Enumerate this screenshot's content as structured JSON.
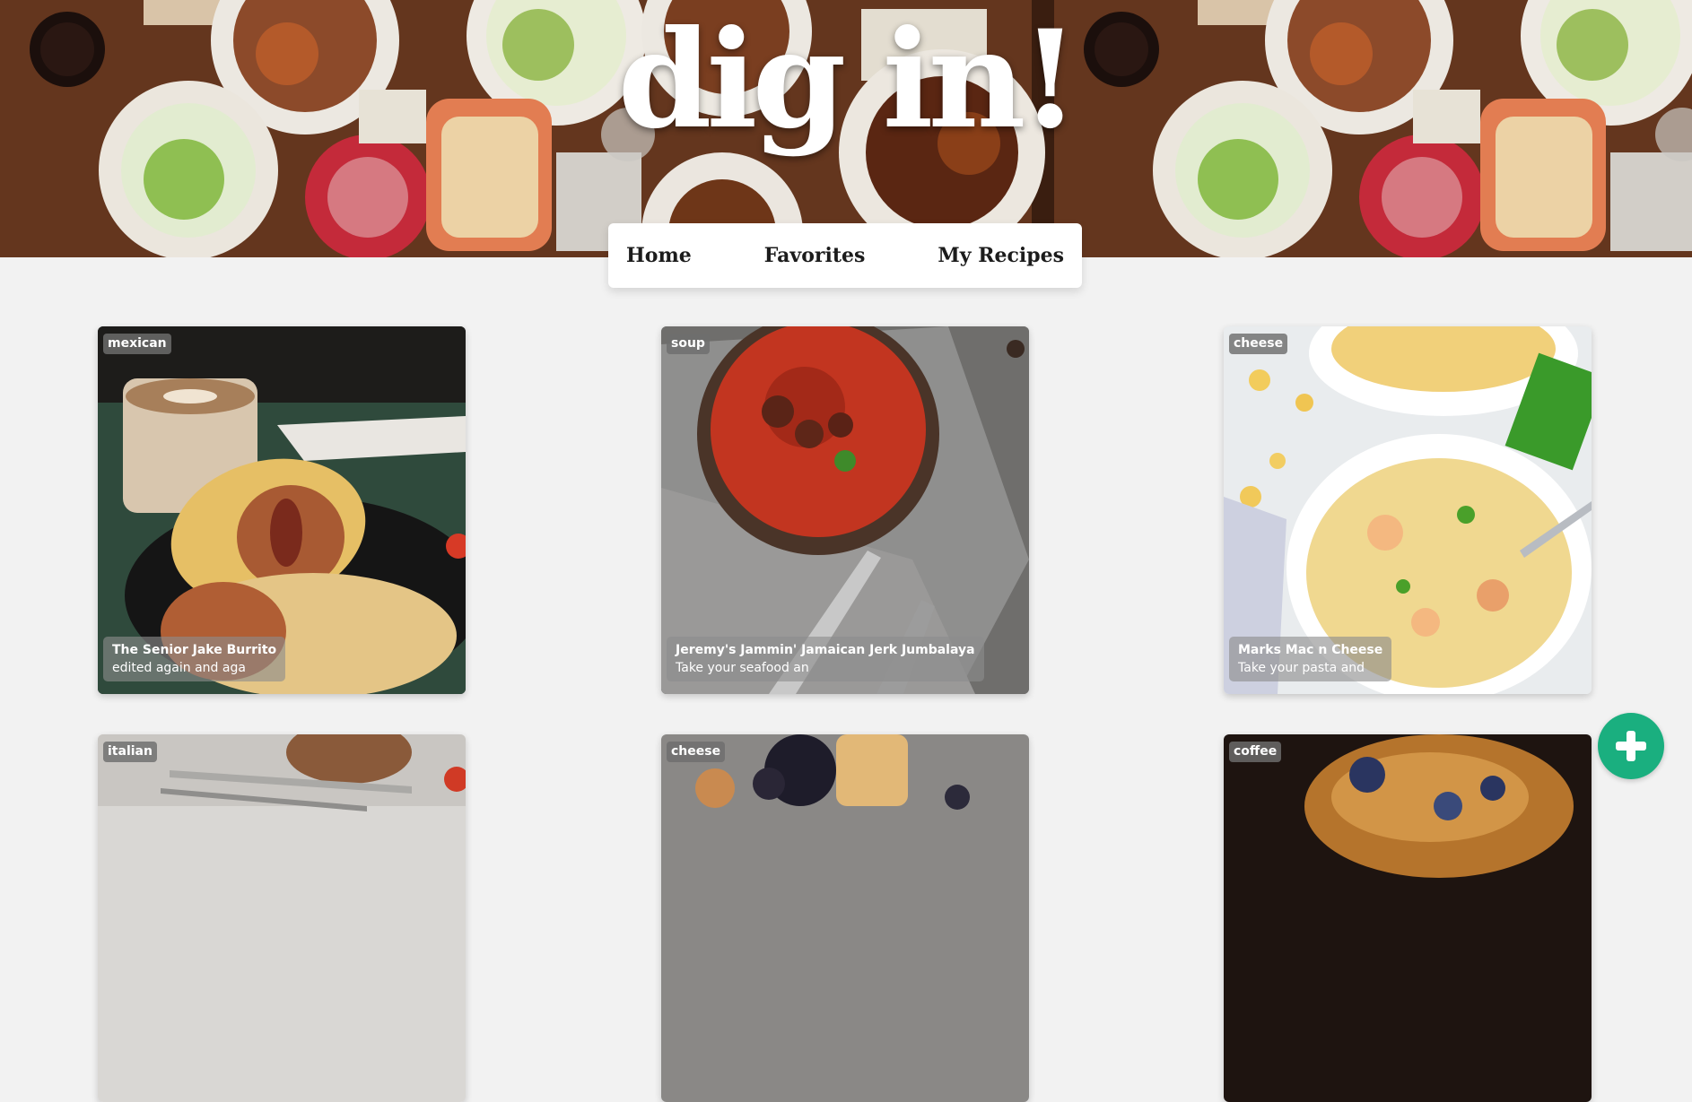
{
  "hero": {
    "title": "dig in!"
  },
  "nav": {
    "items": [
      "Home",
      "Favorites",
      "My Recipes"
    ]
  },
  "cards": [
    {
      "tag": "mexican",
      "title": "The Senior Jake Burrito",
      "description": "edited again and aga"
    },
    {
      "tag": "soup",
      "title": "Jeremy's Jammin' Jamaican Jerk Jumbalaya",
      "description": "Take your seafood an"
    },
    {
      "tag": "cheese",
      "title": "Marks Mac n Cheese",
      "description": "Take your pasta and"
    },
    {
      "tag": "italian"
    },
    {
      "tag": "cheese"
    },
    {
      "tag": "coffee"
    }
  ],
  "fab": {
    "icon": "plus-icon"
  },
  "colors": {
    "accent": "#1aaf7f",
    "background": "#f2f2f2",
    "nav_background": "#ffffff"
  }
}
